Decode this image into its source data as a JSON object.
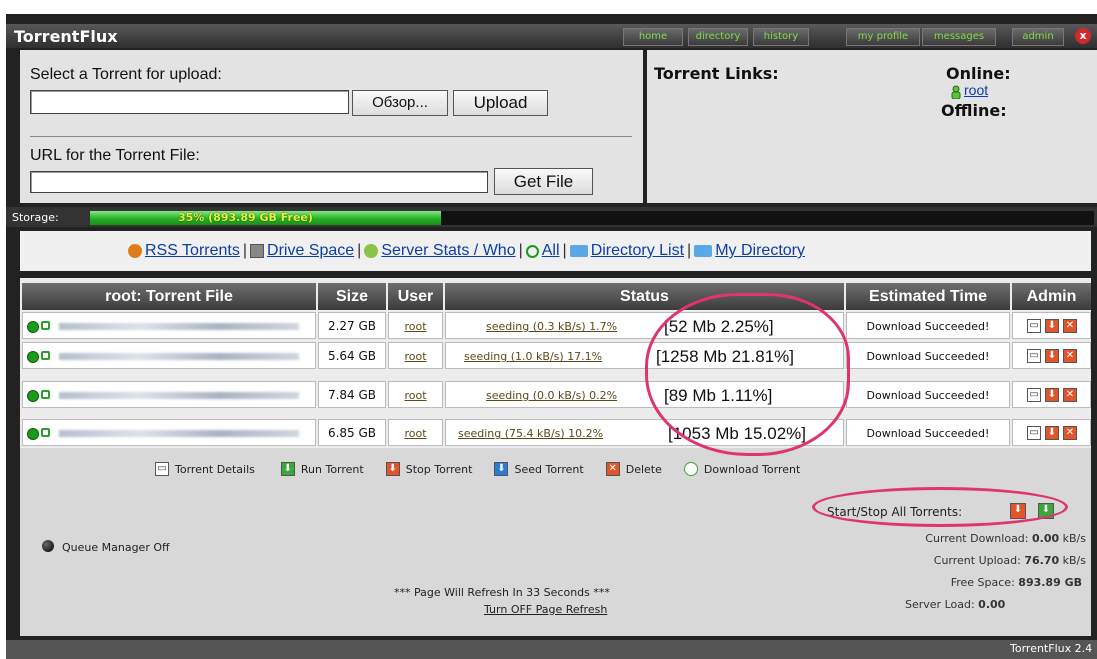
{
  "app": {
    "title": "TorrentFlux",
    "version": "TorrentFlux 2.4"
  },
  "nav": {
    "items": [
      "home",
      "directory",
      "history",
      "my profile",
      "messages",
      "admin"
    ],
    "close": "x"
  },
  "upload": {
    "select_label": "Select a Torrent for upload:",
    "browse_button": "Обзор...",
    "upload_button": "Upload",
    "url_label": "URL for the Torrent File:",
    "get_file_button": "Get File",
    "file_value": "",
    "url_value": ""
  },
  "links_panel": {
    "torrent_links": "Torrent Links:",
    "online": "Online:",
    "online_user": "root",
    "offline": "Offline:"
  },
  "storage": {
    "label": "Storage:",
    "text": "35% (893.89 GB Free)",
    "fill_fraction": 0.35
  },
  "toolbar_links": {
    "rss": "RSS Torrents",
    "drive": "Drive Space",
    "server": "Server Stats / Who",
    "all": "All",
    "dirlist": "Directory List",
    "mydir": "My Directory",
    "sep": "|"
  },
  "table": {
    "headers": [
      "root: Torrent File",
      "Size",
      "User",
      "Status",
      "Estimated Time",
      "Admin"
    ],
    "rows": [
      {
        "size": "2.27 GB",
        "user": "root",
        "status": "seeding (0.3 kB/s) 1.7%",
        "share": "[52 Mb 2.25%]",
        "eta": "Download Succeeded!"
      },
      {
        "size": "5.64 GB",
        "user": "root",
        "status": "seeding (1.0 kB/s) 17.1%",
        "share": "[1258 Mb 21.81%]",
        "eta": "Download Succeeded!"
      },
      {
        "size": "7.84 GB",
        "user": "root",
        "status": "seeding (0.0 kB/s) 0.2%",
        "share": "[89 Mb 1.11%]",
        "eta": "Download Succeeded!"
      },
      {
        "size": "6.85 GB",
        "user": "root",
        "status": "seeding (75.4 kB/s) 10.2%",
        "share": "[1053 Mb 15.02%]",
        "eta": "Download Succeeded!"
      }
    ]
  },
  "legend": {
    "details": "Torrent Details",
    "run": "Run Torrent",
    "stop": "Stop Torrent",
    "seed": "Seed Torrent",
    "delete": "Delete",
    "download": "Download Torrent"
  },
  "bottom": {
    "startstop_all": "Start/Stop All Torrents:",
    "queue_manager": "Queue Manager Off",
    "refresh_text": "*** Page Will Refresh In 33 Seconds ***",
    "turn_off_refresh": "Turn OFF Page Refresh",
    "current_download_label": "Current Download:",
    "current_download_value": "0.00",
    "current_download_unit": "kB/s",
    "current_upload_label": "Current Upload:",
    "current_upload_value": "76.70",
    "current_upload_unit": "kB/s",
    "free_space_label": "Free Space:",
    "free_space_value": "893.89 GB",
    "server_load_label": "Server Load:",
    "server_load_value": "0.00"
  },
  "colors": {
    "accent_green": "#23b023",
    "nav_text": "#7fdc46",
    "link_blue": "#0b3ea8",
    "annotation_pink": "#e0356a"
  }
}
